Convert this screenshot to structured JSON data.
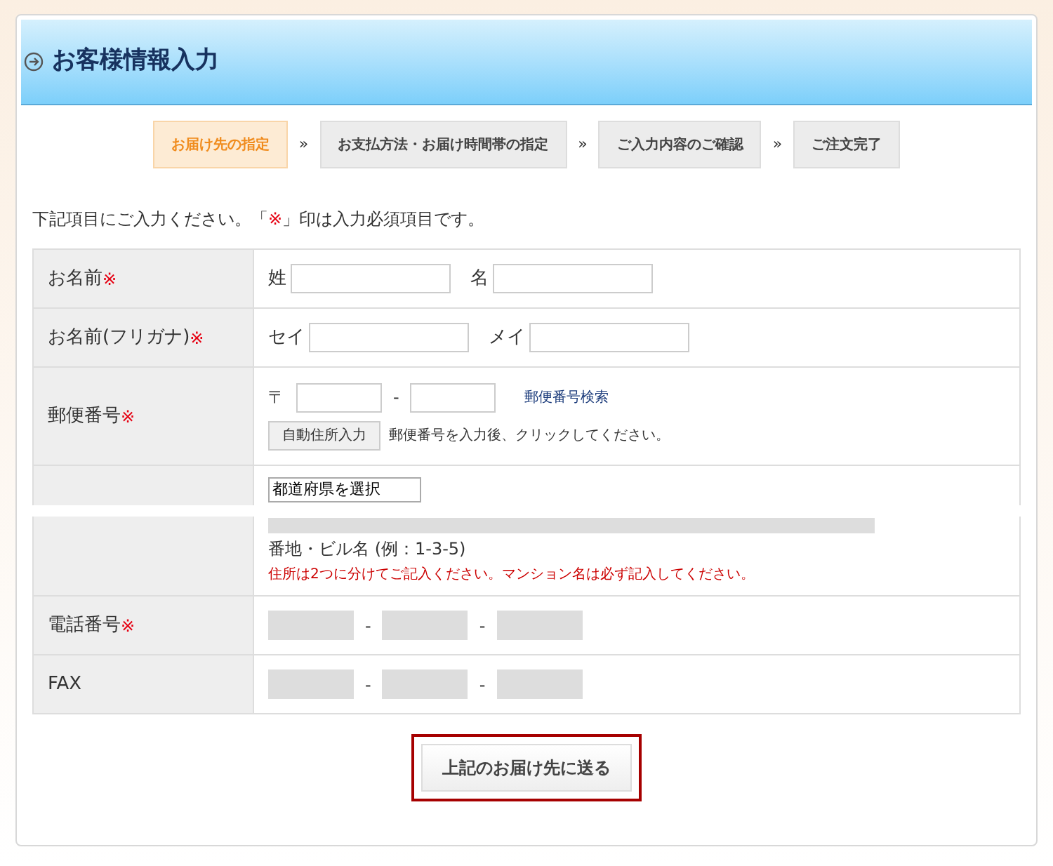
{
  "header": {
    "title": "お客様情報入力"
  },
  "steps": [
    {
      "label": "お届け先の指定",
      "selected": true
    },
    {
      "label": "お支払方法・お届け時間帯の指定",
      "selected": false
    },
    {
      "label": "ご入力内容のご確認",
      "selected": false
    },
    {
      "label": "ご注文完了",
      "selected": false
    }
  ],
  "step_separator": "»",
  "intro": {
    "before": "下記項目にご入力ください。「",
    "mark": "※",
    "after": "」印は入力必須項目です。"
  },
  "rows": [
    {
      "kind": "pair",
      "label": "お名前",
      "required": true,
      "fields": [
        {
          "label": "姓"
        },
        {
          "label": "名"
        }
      ]
    },
    {
      "kind": "pair",
      "label": "お名前(フリガナ)",
      "required": true,
      "fields": [
        {
          "label": "セイ"
        },
        {
          "label": "メイ"
        }
      ]
    },
    {
      "kind": "zip",
      "label": "郵便番号",
      "required": true,
      "prefix": "〒",
      "separator": "-",
      "link": "郵便番号検索",
      "button": "自動住所入力",
      "hint": "郵便番号を入力後、クリックしてください。"
    },
    {
      "kind": "address",
      "select": "都道府県を選択",
      "caption": "番地・ビル名 (例：1-3-5)",
      "note": "住所は2つに分けてご記入ください。マンション名は必ず記入してください。"
    },
    {
      "kind": "phone",
      "label": "電話番号",
      "required": true,
      "separators": [
        "-",
        "-"
      ]
    },
    {
      "kind": "phone",
      "label": "FAX",
      "required": false,
      "separators": [
        "-",
        "-"
      ]
    }
  ],
  "submit": {
    "label": "上記のお届け先に送る"
  }
}
